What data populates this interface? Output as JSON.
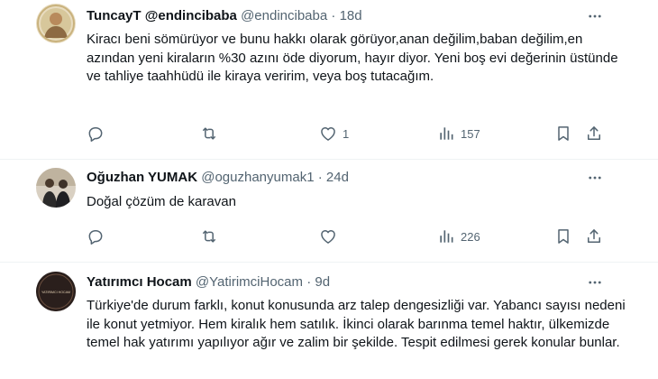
{
  "tweets": [
    {
      "name": "TuncayT",
      "handle_display": "@endincibaba",
      "handle": "@endincibaba",
      "dot": "·",
      "time": "18d",
      "text": "Kiracı beni sömürüyor ve bunu hakkı olarak görüyor,anan değilim,baban değilim,en azından yeni kiraların %30 azını öde diyorum, hayır diyor. Yeni boş evi değerinin üstünde ve tahliye taahhüdü ile kiraya veririm, veya boş tutacağım.",
      "replies": "",
      "retweets": "",
      "likes": "1",
      "views": "157"
    },
    {
      "name": "Oğuzhan YUMAK",
      "handle": "@oguzhanyumak1",
      "dot": "·",
      "time": "24d",
      "text": "Doğal çözüm de karavan",
      "replies": "",
      "retweets": "",
      "likes": "",
      "views": "226"
    },
    {
      "name": "Yatırımcı Hocam",
      "handle": "@YatirimciHocam",
      "dot": "·",
      "time": "9d",
      "text": "Türkiye'de durum farklı, konut konusunda arz talep dengesizliği var. Yabancı sayısı nedeni ile konut yetmiyor. Hem kiralık hem satılık. İkinci olarak barınma temel haktır, ülkemizde temel hak yatırımı yapılıyor ağır ve zalim bir şekilde. Tespit edilmesi gerek konular bunlar.",
      "avatar_text": "YATIRIMCI HOCAM"
    }
  ],
  "colors": {
    "accent": "#1d9bf0",
    "muted": "#536471",
    "text": "#0f1419",
    "divider": "#eff3f4"
  },
  "icons": [
    "reply-icon",
    "retweet-icon",
    "like-icon",
    "views-icon",
    "bookmark-icon",
    "share-icon",
    "more-icon"
  ]
}
